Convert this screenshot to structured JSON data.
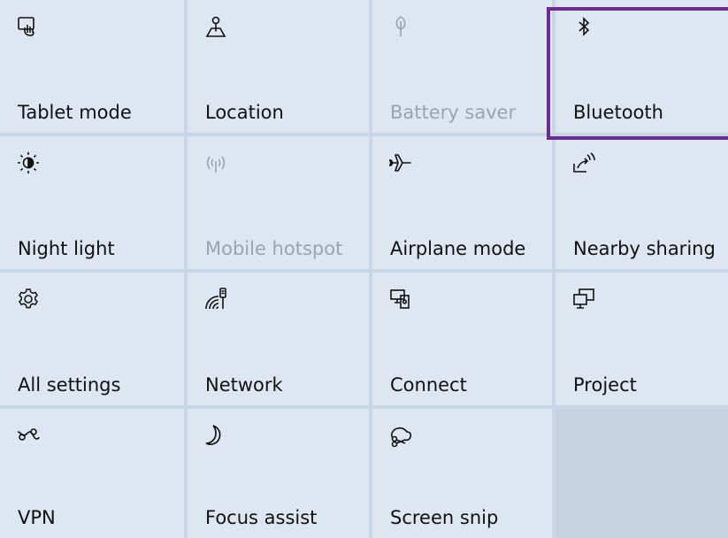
{
  "panel": {
    "tiles": [
      {
        "label": "Tablet mode",
        "icon": "tablet-mode-icon"
      },
      {
        "label": "Location",
        "icon": "location-icon"
      },
      {
        "label": "Battery saver",
        "icon": "battery-saver-icon",
        "disabled": true
      },
      {
        "label": "Bluetooth",
        "icon": "bluetooth-icon",
        "highlighted": true
      },
      {
        "label": "Night light",
        "icon": "night-light-icon"
      },
      {
        "label": "Mobile hotspot",
        "icon": "mobile-hotspot-icon",
        "disabled": true
      },
      {
        "label": "Airplane mode",
        "icon": "airplane-icon"
      },
      {
        "label": "Nearby sharing",
        "icon": "nearby-sharing-icon"
      },
      {
        "label": "All settings",
        "icon": "gear-icon"
      },
      {
        "label": "Network",
        "icon": "network-icon"
      },
      {
        "label": "Connect",
        "icon": "connect-icon"
      },
      {
        "label": "Project",
        "icon": "project-icon"
      },
      {
        "label": "VPN",
        "icon": "vpn-icon"
      },
      {
        "label": "Focus assist",
        "icon": "focus-assist-icon"
      },
      {
        "label": "Screen snip",
        "icon": "screen-snip-icon"
      }
    ]
  },
  "colors": {
    "tile_background": "#dde6f1",
    "grid_gap": "#c9d6e5",
    "disabled_text": "#9ba3ad",
    "highlight_border": "#6b2c91"
  }
}
